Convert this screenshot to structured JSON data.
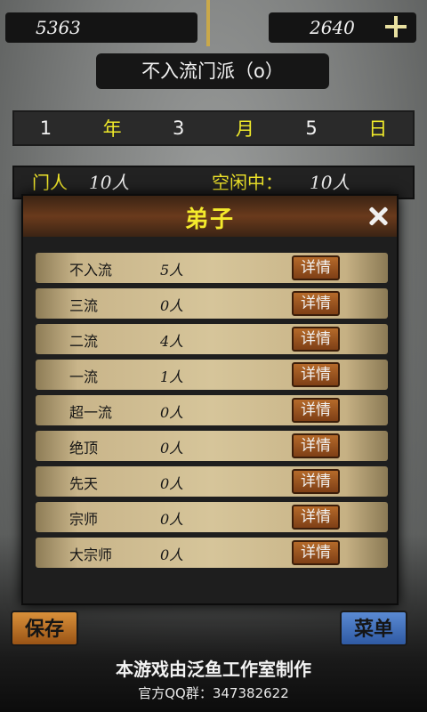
{
  "resources": {
    "left_value": "5363",
    "right_value": "2640",
    "plus_icon": "plus-icon"
  },
  "sect_title": "不入流门派（o）",
  "date": {
    "year_num": "1",
    "year_unit": "年",
    "month_num": "3",
    "month_unit": "月",
    "day_num": "5",
    "day_unit": "日"
  },
  "members": {
    "label1": "门人",
    "value1": "10人",
    "label2": "空闲中：",
    "value2": "10人"
  },
  "dialog": {
    "title": "弟子",
    "close_icon": "close-icon",
    "rows": [
      {
        "name": "不入流",
        "count": "5人",
        "btn": "详情"
      },
      {
        "name": "三流",
        "count": "0人",
        "btn": "详情"
      },
      {
        "name": "二流",
        "count": "4人",
        "btn": "详情"
      },
      {
        "name": "一流",
        "count": "1人",
        "btn": "详情"
      },
      {
        "name": "超一流",
        "count": "0人",
        "btn": "详情"
      },
      {
        "name": "绝顶",
        "count": "0人",
        "btn": "详情"
      },
      {
        "name": "先天",
        "count": "0人",
        "btn": "详情"
      },
      {
        "name": "宗师",
        "count": "0人",
        "btn": "详情"
      },
      {
        "name": "大宗师",
        "count": "0人",
        "btn": "详情"
      }
    ]
  },
  "buttons": {
    "save": "保存",
    "menu": "菜单"
  },
  "footer": {
    "line1": "本游戏由泛鱼工作室制作",
    "line2": "官方QQ群：347382622"
  },
  "colors": {
    "accent_yellow": "#f1e62a",
    "row_tan": "#d6c59a",
    "button_brown": "#9a5416"
  }
}
